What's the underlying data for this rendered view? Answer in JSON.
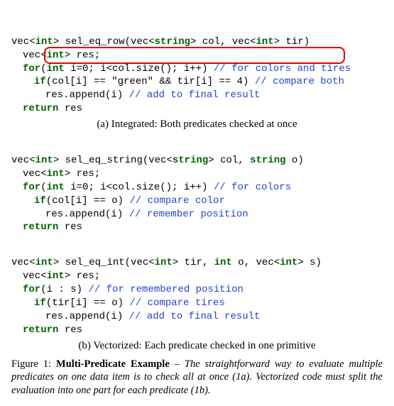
{
  "code_a": {
    "sig_pre": "vec<",
    "sig_kw1": "int",
    "sig_mid1": "> sel_eq_row(vec<",
    "sig_kw2": "string",
    "sig_mid2": "> col, vec<",
    "sig_kw3": "int",
    "sig_post": "> tir)",
    "l2_pre": "vec<",
    "l2_kw": "int",
    "l2_post": "> res;",
    "l3_kw1": "for",
    "l3_pre": "(",
    "l3_kw2": "int",
    "l3_body": " i=0; i<col.size(); i++) ",
    "l3_cm": "// for colors and tires",
    "l4_kw": "if",
    "l4_body": "(col[i] == \"green\" && tir[i] == 4) ",
    "l4_cm": "// compare both",
    "l5_body": "res.append(i) ",
    "l5_cm": "// add to final result",
    "l6_kw": "return",
    "l6_body": " res"
  },
  "caption_a": "(a) Integrated: Both predicates checked at once",
  "code_b1": {
    "sig_pre": "vec<",
    "sig_kw1": "int",
    "sig_mid1": "> sel_eq_string(vec<",
    "sig_kw2": "string",
    "sig_mid2": "> col, ",
    "sig_kw3": "string",
    "sig_post": " o)",
    "l2_pre": "vec<",
    "l2_kw": "int",
    "l2_post": "> res;",
    "l3_kw1": "for",
    "l3_pre": "(",
    "l3_kw2": "int",
    "l3_body": " i=0; i<col.size(); i++) ",
    "l3_cm": "// for colors",
    "l4_kw": "if",
    "l4_body": "(col[i] == o) ",
    "l4_cm": "// compare color",
    "l5_body": "res.append(i) ",
    "l5_cm": "// remember position",
    "l6_kw": "return",
    "l6_body": " res"
  },
  "code_b2": {
    "sig_pre": "vec<",
    "sig_kw1": "int",
    "sig_mid1": "> sel_eq_int(vec<",
    "sig_kw2": "int",
    "sig_mid2": "> tir, ",
    "sig_kw3": "int",
    "sig_mid3": " o, vec<",
    "sig_kw4": "int",
    "sig_post": "> s)",
    "l2_pre": "vec<",
    "l2_kw": "int",
    "l2_post": "> res;",
    "l3_kw1": "for",
    "l3_body": "(i : s) ",
    "l3_cm": "// for remembered position",
    "l4_kw": "if",
    "l4_body": "(tir[i] == o) ",
    "l4_cm": "// compare tires",
    "l5_body": "res.append(i) ",
    "l5_cm": "// add to final result",
    "l6_kw": "return",
    "l6_body": " res"
  },
  "caption_b": "(b) Vectorized: Each predicate checked in one primitive",
  "figure": {
    "label": "Figure 1: ",
    "title": "Multi-Predicate Example",
    "sep": " – ",
    "body": "The straightforward way to evaluate multiple predicates on one data item is to check all at once (1a). Vectorized code must split the evaluation into one part for each predicate (1b)."
  }
}
